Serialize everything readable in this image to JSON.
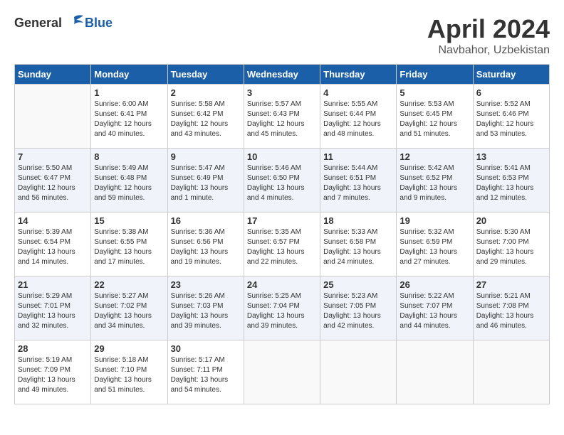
{
  "header": {
    "logo_general": "General",
    "logo_blue": "Blue",
    "month": "April 2024",
    "location": "Navbahor, Uzbekistan"
  },
  "weekdays": [
    "Sunday",
    "Monday",
    "Tuesday",
    "Wednesday",
    "Thursday",
    "Friday",
    "Saturday"
  ],
  "weeks": [
    [
      {
        "day": "",
        "info": ""
      },
      {
        "day": "1",
        "info": "Sunrise: 6:00 AM\nSunset: 6:41 PM\nDaylight: 12 hours\nand 40 minutes."
      },
      {
        "day": "2",
        "info": "Sunrise: 5:58 AM\nSunset: 6:42 PM\nDaylight: 12 hours\nand 43 minutes."
      },
      {
        "day": "3",
        "info": "Sunrise: 5:57 AM\nSunset: 6:43 PM\nDaylight: 12 hours\nand 45 minutes."
      },
      {
        "day": "4",
        "info": "Sunrise: 5:55 AM\nSunset: 6:44 PM\nDaylight: 12 hours\nand 48 minutes."
      },
      {
        "day": "5",
        "info": "Sunrise: 5:53 AM\nSunset: 6:45 PM\nDaylight: 12 hours\nand 51 minutes."
      },
      {
        "day": "6",
        "info": "Sunrise: 5:52 AM\nSunset: 6:46 PM\nDaylight: 12 hours\nand 53 minutes."
      }
    ],
    [
      {
        "day": "7",
        "info": "Sunrise: 5:50 AM\nSunset: 6:47 PM\nDaylight: 12 hours\nand 56 minutes."
      },
      {
        "day": "8",
        "info": "Sunrise: 5:49 AM\nSunset: 6:48 PM\nDaylight: 12 hours\nand 59 minutes."
      },
      {
        "day": "9",
        "info": "Sunrise: 5:47 AM\nSunset: 6:49 PM\nDaylight: 13 hours\nand 1 minute."
      },
      {
        "day": "10",
        "info": "Sunrise: 5:46 AM\nSunset: 6:50 PM\nDaylight: 13 hours\nand 4 minutes."
      },
      {
        "day": "11",
        "info": "Sunrise: 5:44 AM\nSunset: 6:51 PM\nDaylight: 13 hours\nand 7 minutes."
      },
      {
        "day": "12",
        "info": "Sunrise: 5:42 AM\nSunset: 6:52 PM\nDaylight: 13 hours\nand 9 minutes."
      },
      {
        "day": "13",
        "info": "Sunrise: 5:41 AM\nSunset: 6:53 PM\nDaylight: 13 hours\nand 12 minutes."
      }
    ],
    [
      {
        "day": "14",
        "info": "Sunrise: 5:39 AM\nSunset: 6:54 PM\nDaylight: 13 hours\nand 14 minutes."
      },
      {
        "day": "15",
        "info": "Sunrise: 5:38 AM\nSunset: 6:55 PM\nDaylight: 13 hours\nand 17 minutes."
      },
      {
        "day": "16",
        "info": "Sunrise: 5:36 AM\nSunset: 6:56 PM\nDaylight: 13 hours\nand 19 minutes."
      },
      {
        "day": "17",
        "info": "Sunrise: 5:35 AM\nSunset: 6:57 PM\nDaylight: 13 hours\nand 22 minutes."
      },
      {
        "day": "18",
        "info": "Sunrise: 5:33 AM\nSunset: 6:58 PM\nDaylight: 13 hours\nand 24 minutes."
      },
      {
        "day": "19",
        "info": "Sunrise: 5:32 AM\nSunset: 6:59 PM\nDaylight: 13 hours\nand 27 minutes."
      },
      {
        "day": "20",
        "info": "Sunrise: 5:30 AM\nSunset: 7:00 PM\nDaylight: 13 hours\nand 29 minutes."
      }
    ],
    [
      {
        "day": "21",
        "info": "Sunrise: 5:29 AM\nSunset: 7:01 PM\nDaylight: 13 hours\nand 32 minutes."
      },
      {
        "day": "22",
        "info": "Sunrise: 5:27 AM\nSunset: 7:02 PM\nDaylight: 13 hours\nand 34 minutes."
      },
      {
        "day": "23",
        "info": "Sunrise: 5:26 AM\nSunset: 7:03 PM\nDaylight: 13 hours\nand 39 minutes."
      },
      {
        "day": "24",
        "info": "Sunrise: 5:25 AM\nSunset: 7:04 PM\nDaylight: 13 hours\nand 39 minutes."
      },
      {
        "day": "25",
        "info": "Sunrise: 5:23 AM\nSunset: 7:05 PM\nDaylight: 13 hours\nand 42 minutes."
      },
      {
        "day": "26",
        "info": "Sunrise: 5:22 AM\nSunset: 7:07 PM\nDaylight: 13 hours\nand 44 minutes."
      },
      {
        "day": "27",
        "info": "Sunrise: 5:21 AM\nSunset: 7:08 PM\nDaylight: 13 hours\nand 46 minutes."
      }
    ],
    [
      {
        "day": "28",
        "info": "Sunrise: 5:19 AM\nSunset: 7:09 PM\nDaylight: 13 hours\nand 49 minutes."
      },
      {
        "day": "29",
        "info": "Sunrise: 5:18 AM\nSunset: 7:10 PM\nDaylight: 13 hours\nand 51 minutes."
      },
      {
        "day": "30",
        "info": "Sunrise: 5:17 AM\nSunset: 7:11 PM\nDaylight: 13 hours\nand 54 minutes."
      },
      {
        "day": "",
        "info": ""
      },
      {
        "day": "",
        "info": ""
      },
      {
        "day": "",
        "info": ""
      },
      {
        "day": "",
        "info": ""
      }
    ]
  ]
}
